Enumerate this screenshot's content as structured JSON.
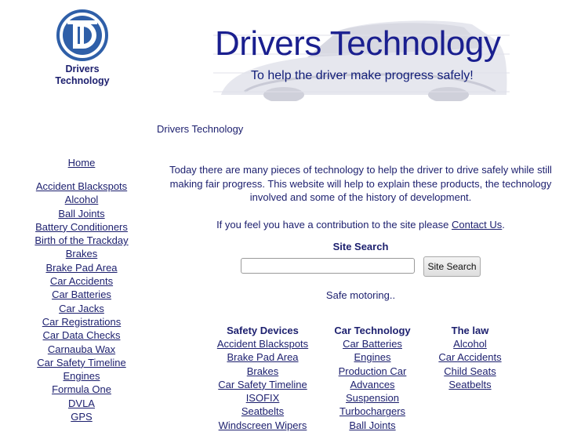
{
  "logo": {
    "line1": "Drivers",
    "line2": "Technology"
  },
  "banner": {
    "title": "Drivers Technology",
    "tagline": "To help the driver make progress safely!"
  },
  "breadcrumb": "Drivers Technology",
  "sidebar": {
    "home": "Home",
    "items": [
      "Accident Blackspots",
      "Alcohol",
      "Ball Joints",
      "Battery Conditioners",
      "Birth of the Trackday",
      "Brakes",
      "Brake Pad Area",
      "Car Accidents",
      "Car Batteries",
      "Car Jacks",
      "Car Registrations",
      "Car Data Checks",
      "Carnauba Wax",
      "Car Safety Timeline",
      "Engines",
      "Formula One",
      "DVLA",
      "GPS"
    ]
  },
  "main": {
    "intro": "Today there are many pieces of technology to help the driver to drive safely while still making fair progress. This website will help to explain these products, the technology involved and some of the history of development.",
    "contribute_prefix": "If you feel you have a contribution to the site please ",
    "contact_link": "Contact Us",
    "contribute_suffix": "."
  },
  "search": {
    "label": "Site Search",
    "input_value": "",
    "button_label": "Site Search"
  },
  "safe_motoring": "Safe motoring..",
  "columns": {
    "safety": {
      "title": "Safety Devices",
      "items": [
        "Accident Blackspots",
        "Brake Pad Area",
        "Brakes",
        "Car Safety Timeline",
        "ISOFIX",
        "Seatbelts",
        "Windscreen Wipers"
      ]
    },
    "tech": {
      "title": "Car Technology",
      "items": [
        "Car Batteries",
        "Engines",
        "Production Car",
        "Advances",
        "Suspension",
        "Turbochargers",
        "Ball Joints"
      ]
    },
    "law": {
      "title": "The law",
      "items": [
        "Alcohol",
        "Car Accidents",
        "Child Seats",
        "Seatbelts"
      ]
    }
  },
  "colors": {
    "text": "#1c1f6e",
    "banner_title": "#1a1f8f",
    "logo_blue": "#2f5fa8"
  }
}
